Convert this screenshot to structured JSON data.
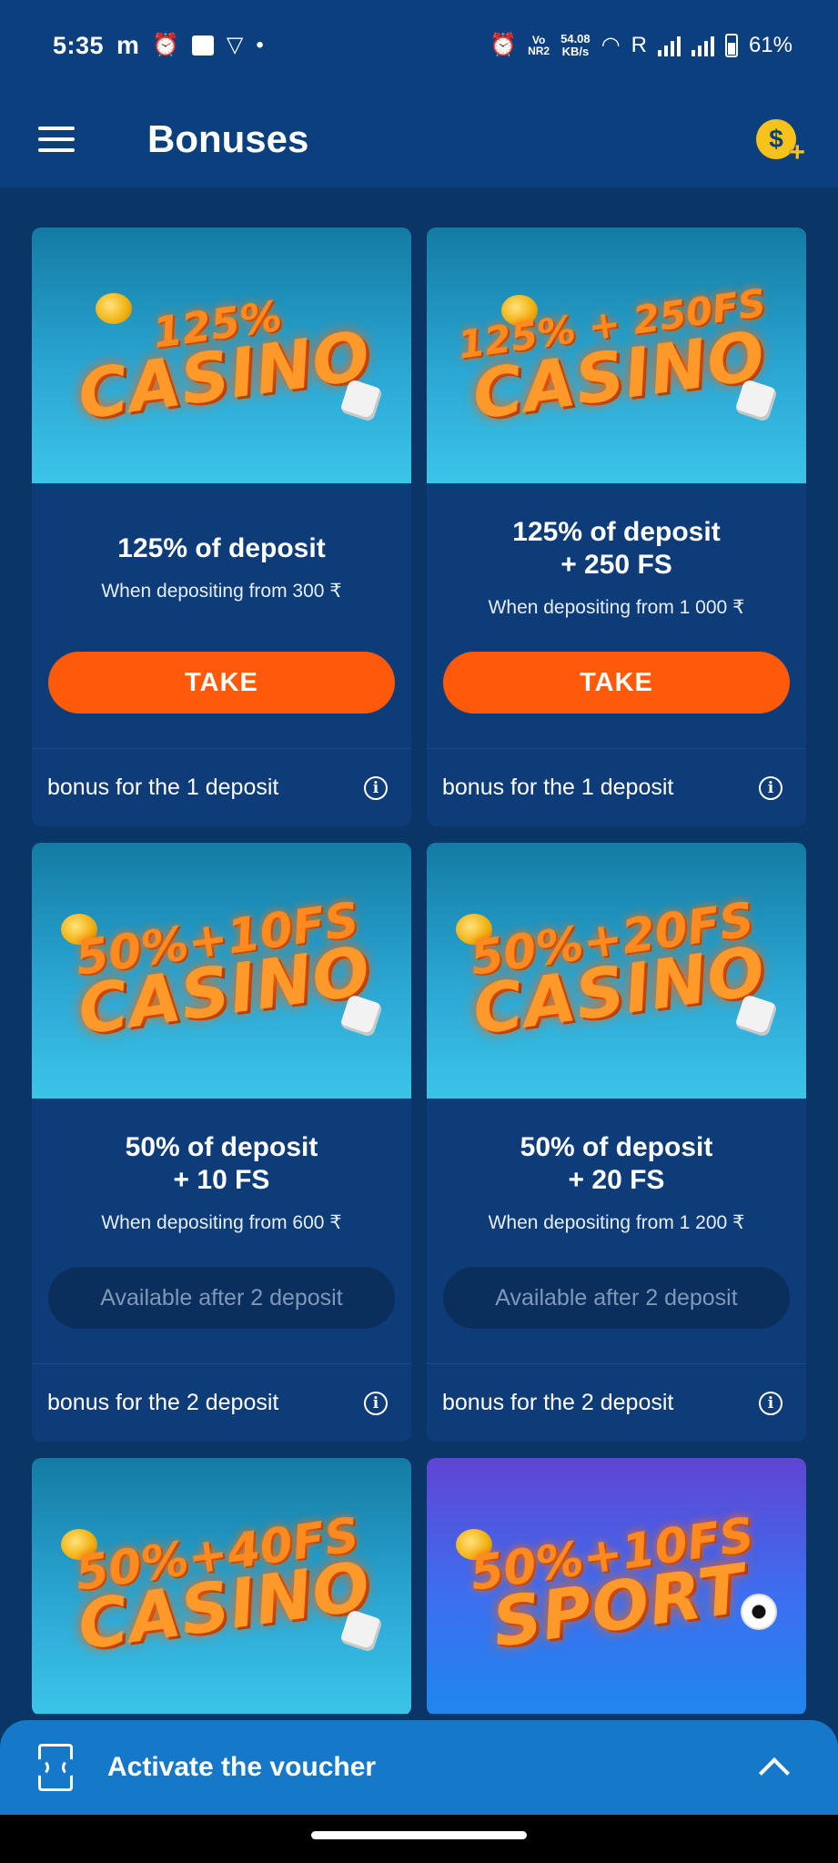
{
  "status_bar": {
    "time": "5:35",
    "left_icons": [
      "m-app-icon",
      "alarm-icon",
      "game-app-icon",
      "vpn-icon",
      "dot-icon"
    ],
    "vo_label": "Vo\nNR2",
    "net_speed_value": "54.08",
    "net_speed_unit": "KB/s",
    "roaming": "R",
    "battery": "61%"
  },
  "header": {
    "title": "Bonuses",
    "deposit_symbol": "$",
    "deposit_plus": "+"
  },
  "cards": [
    {
      "banner_top": "125%",
      "banner_main": "CASINO",
      "title": "125% of deposit",
      "subtitle": "When depositing from 300 ₹",
      "button": "TAKE",
      "footer": "bonus for the 1 deposit"
    },
    {
      "banner_top": "125% + 250FS",
      "banner_main": "CASINO",
      "title": "125% of deposit\n+ 250 FS",
      "subtitle": "When depositing from 1 000 ₹",
      "button": "TAKE",
      "footer": "bonus for the 1 deposit"
    },
    {
      "banner_top": "50%+10FS",
      "banner_main": "CASINO",
      "title": "50% of deposit\n+ 10 FS",
      "subtitle": "When depositing from 600 ₹",
      "button": "Available after 2 deposit",
      "footer": "bonus for the 2 deposit"
    },
    {
      "banner_top": "50%+20FS",
      "banner_main": "CASINO",
      "title": "50% of deposit\n+ 20 FS",
      "subtitle": "When depositing from 1 200 ₹",
      "button": "Available after 2 deposit",
      "footer": "bonus for the 2 deposit"
    },
    {
      "banner_top": "50%+40FS",
      "banner_main": "CASINO"
    },
    {
      "banner_top": "50%+10FS",
      "banner_main": "SPORT"
    }
  ],
  "info_glyph": "i",
  "voucher": {
    "label": "Activate the voucher"
  },
  "colors": {
    "background": "#0a3567",
    "header": "#0b3f7e",
    "card": "#0d3c78",
    "take_button": "#ff5a0a",
    "locked_button": "#0a2f5c",
    "voucher_bar": "#1678c9",
    "coin": "#f7c21a"
  }
}
